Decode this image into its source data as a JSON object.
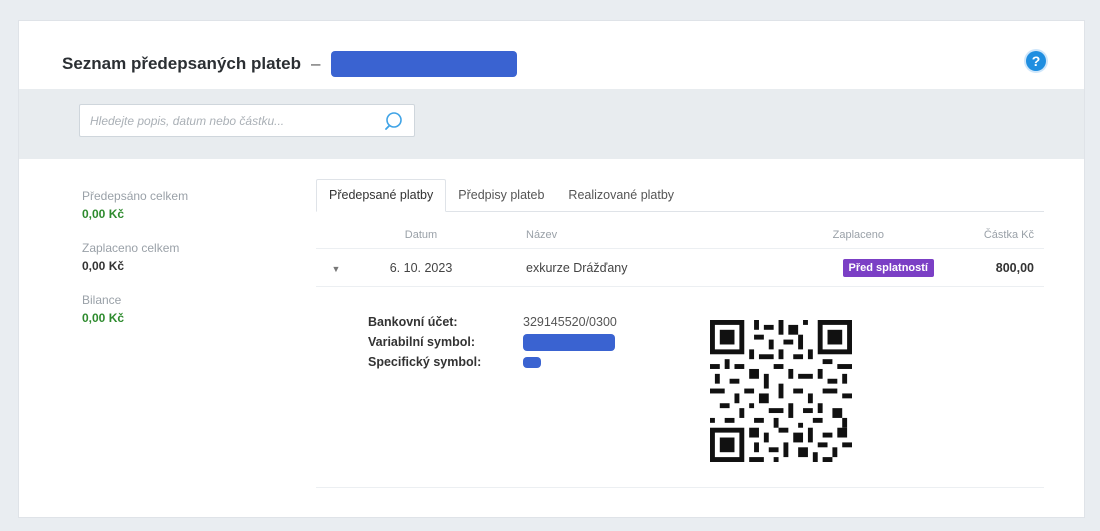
{
  "header": {
    "title": "Seznam předepsaných plateb",
    "separator": "–",
    "help_label": "?"
  },
  "search": {
    "placeholder": "Hledejte popis, datum nebo částku..."
  },
  "summary": [
    {
      "label": "Předepsáno celkem",
      "value": "0,00 Kč",
      "color": "#2e8b2e"
    },
    {
      "label": "Zaplaceno celkem",
      "value": "0,00 Kč",
      "color": "#333333"
    },
    {
      "label": "Bilance",
      "value": "0,00 Kč",
      "color": "#2e8b2e"
    }
  ],
  "tabs": [
    {
      "label": "Předepsané platby",
      "active": true
    },
    {
      "label": "Předpisy plateb",
      "active": false
    },
    {
      "label": "Realizované platby",
      "active": false
    }
  ],
  "table": {
    "columns": [
      "Datum",
      "Název",
      "Zaplaceno",
      "Částka Kč"
    ],
    "rows": [
      {
        "date": "6. 10. 2023",
        "name": "exkurze Drážďany",
        "status": "Před splatností",
        "amount": "800,00"
      }
    ]
  },
  "details": {
    "bank_account_label": "Bankovní účet:",
    "bank_account_value": "329145520/0300",
    "variable_symbol_label": "Variabilní symbol:",
    "specific_symbol_label": "Specifický symbol:"
  },
  "colors": {
    "accent": "#1f8ee0",
    "badge": "#7b3fc5",
    "positive": "#2e8b2e",
    "redaction": "#3a63d1"
  }
}
